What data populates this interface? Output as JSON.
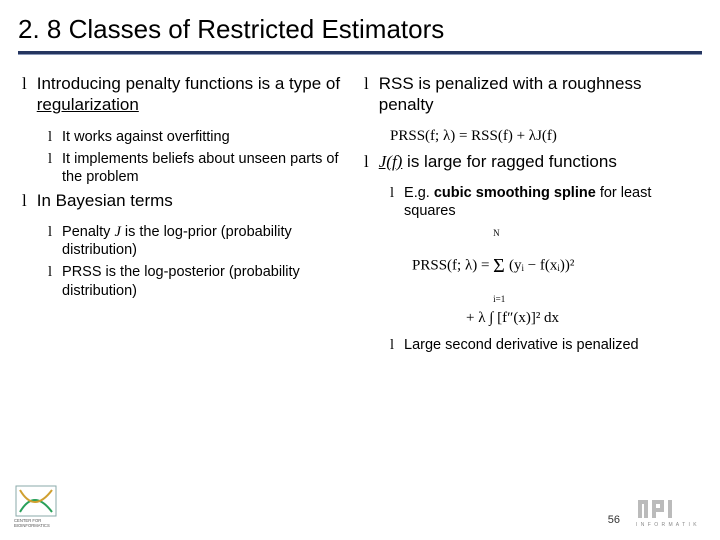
{
  "title": "2. 8 Classes of Restricted Estimators",
  "bullet_glyph": "l",
  "left": {
    "p1_a": "Introducing penalty functions is a type of ",
    "p1_b": "regularization",
    "p1_sub1": "It works against overfitting",
    "p1_sub2": "It implements beliefs about unseen parts of the problem",
    "p2": "In Bayesian terms",
    "p2_sub1_a": "Penalty ",
    "p2_sub1_b": "J",
    "p2_sub1_c": " is the log-prior (probability distribution)",
    "p2_sub2": "PRSS is the log-posterior (probability distribution)"
  },
  "right": {
    "p1": "RSS is penalized with a roughness penalty",
    "eq1": "PRSS(f; λ) = RSS(f) + λJ(f)",
    "p2_a": "J(f)",
    "p2_b": " is large for ragged functions",
    "p2_sub1_a": "E.g. ",
    "p2_sub1_b": "cubic smoothing spline",
    "p2_sub1_c": " for least squares",
    "eq2_line1_pre": "PRSS(f; λ) = ",
    "eq2_line1_sum": "Σ",
    "eq2_line1_bounds_top": "N",
    "eq2_line1_bounds_bot": "i=1",
    "eq2_line1_body": "(yᵢ − f(xᵢ))²",
    "eq2_line2": "+ λ ∫ [f″(x)]² dx",
    "p2_sub2": "Large second derivative is penalized"
  },
  "page_number": "56",
  "logo_left_caption_top": "CENTER FOR",
  "logo_left_caption_bot": "BIOINFORMATICS",
  "logo_right_caption": "I N F O R M A T I K"
}
